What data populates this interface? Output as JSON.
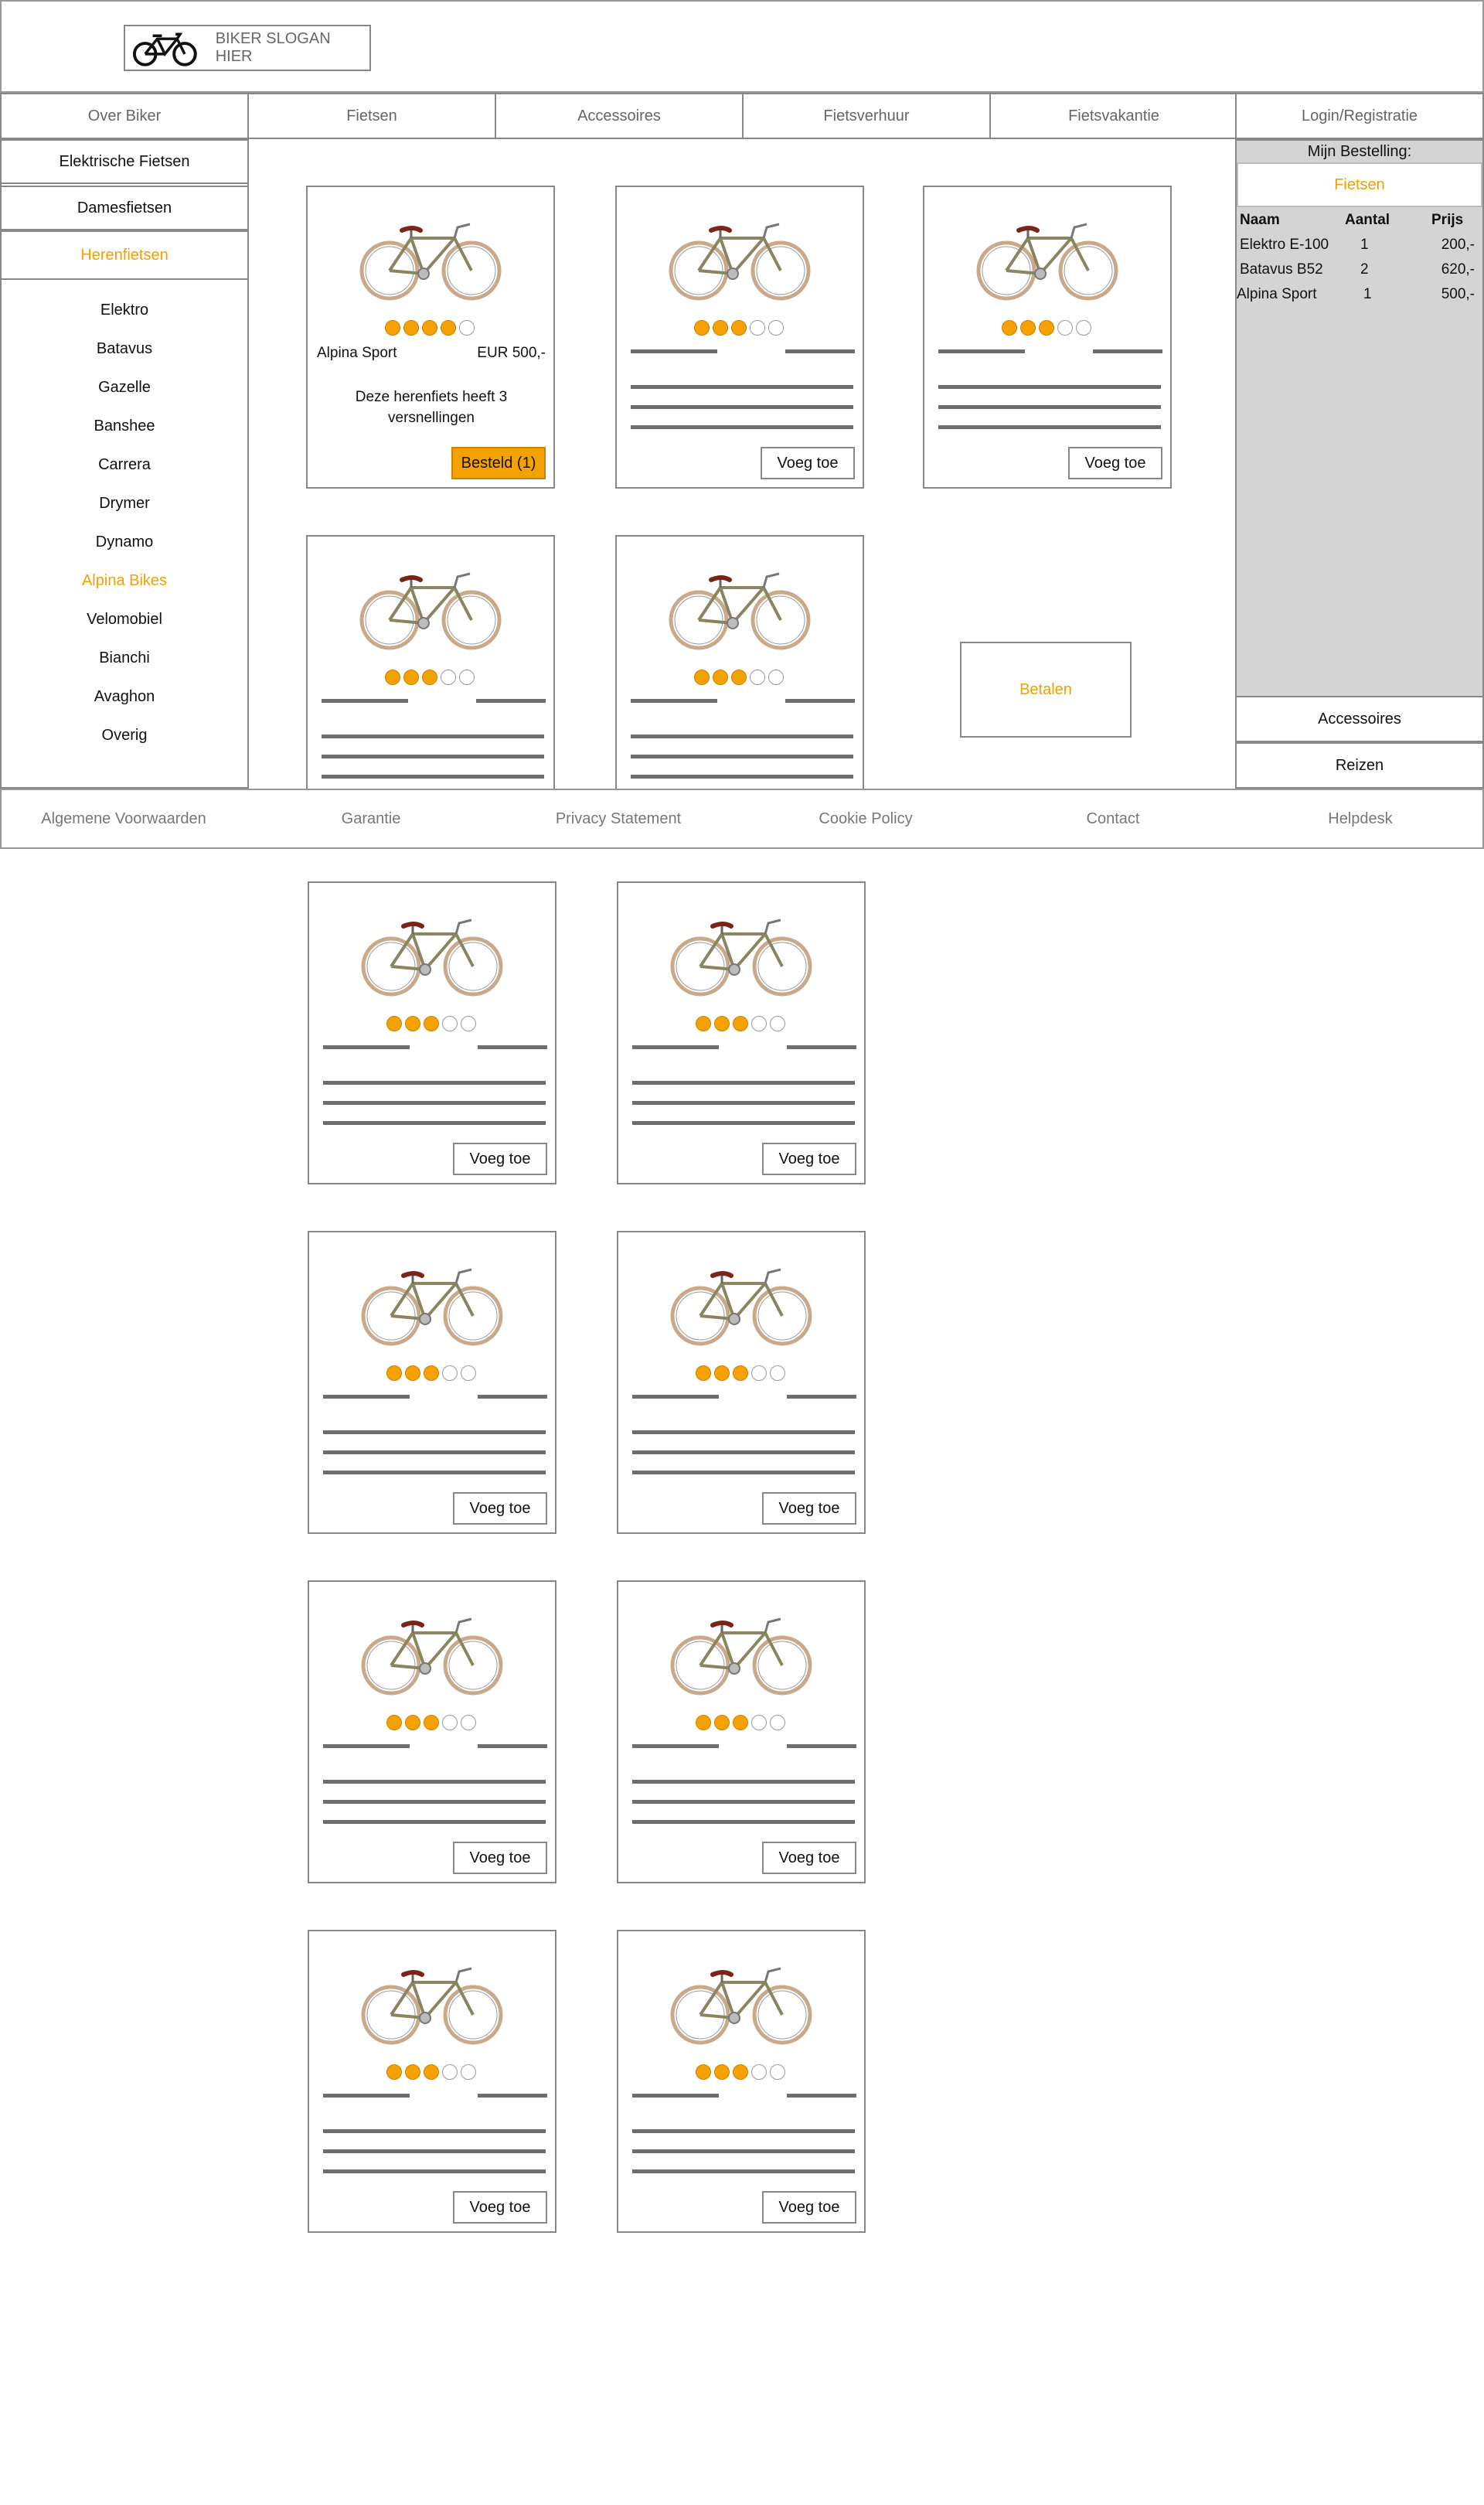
{
  "header": {
    "slogan": "BIKER SLOGAN HIER"
  },
  "nav": {
    "tabs": [
      {
        "label": "Over Biker",
        "active": false
      },
      {
        "label": "Fietsen",
        "active": true
      },
      {
        "label": "Accessoires",
        "active": false
      },
      {
        "label": "Fietsverhuur",
        "active": false
      },
      {
        "label": "Fietsvakantie",
        "active": false
      },
      {
        "label": "Login/Registratie",
        "active": false
      }
    ]
  },
  "sidebar": {
    "categories": [
      {
        "label": "Elektrische Fietsen",
        "active": false
      },
      {
        "label": "Damesfietsen",
        "active": false
      },
      {
        "label": "Herenfietsen",
        "active": true
      }
    ],
    "brands": [
      {
        "label": "Elektro",
        "active": false
      },
      {
        "label": "Batavus",
        "active": false
      },
      {
        "label": "Gazelle",
        "active": false
      },
      {
        "label": "Banshee",
        "active": false
      },
      {
        "label": "Carrera",
        "active": false
      },
      {
        "label": "Drymer",
        "active": false
      },
      {
        "label": "Dynamo",
        "active": false
      },
      {
        "label": "Alpina Bikes",
        "active": true
      },
      {
        "label": "Velomobiel",
        "active": false
      },
      {
        "label": "Bianchi",
        "active": false
      },
      {
        "label": "Avaghon",
        "active": false
      },
      {
        "label": "Overig",
        "active": false
      }
    ]
  },
  "order": {
    "title": "Mijn Bestelling:",
    "tab": "Fietsen",
    "columns": [
      "Naam",
      "Aantal",
      "Prijs"
    ],
    "rows": [
      {
        "naam": "Elektro E-100",
        "aantal": "1",
        "prijs": "200,-"
      },
      {
        "naam": "Batavus B52",
        "aantal": "2",
        "prijs": "620,-"
      },
      {
        "naam": "Alpina Sport",
        "aantal": "1",
        "prijs": "500,-"
      }
    ],
    "buttons": [
      "Accessoires",
      "Reizen"
    ]
  },
  "featured": {
    "name": "Alpina Sport",
    "price": "EUR 500,-",
    "description": "Deze herenfiets heeft 3 versnellingen",
    "ordered_label": "Besteld (1)",
    "rating": 4
  },
  "add_label": "Voeg toe",
  "pay_label": "Betalen",
  "cards_ratings": [
    3,
    3,
    3,
    3,
    3,
    3,
    3,
    3,
    3,
    3,
    3,
    3
  ],
  "footer": {
    "links": [
      "Algemene Voorwaarden",
      "Garantie",
      "Privacy Statement",
      "Cookie Policy",
      "Contact",
      "Helpdesk"
    ]
  },
  "colors": {
    "accent": "#f5a100",
    "border": "#888888",
    "panel": "#d4d4d4"
  }
}
